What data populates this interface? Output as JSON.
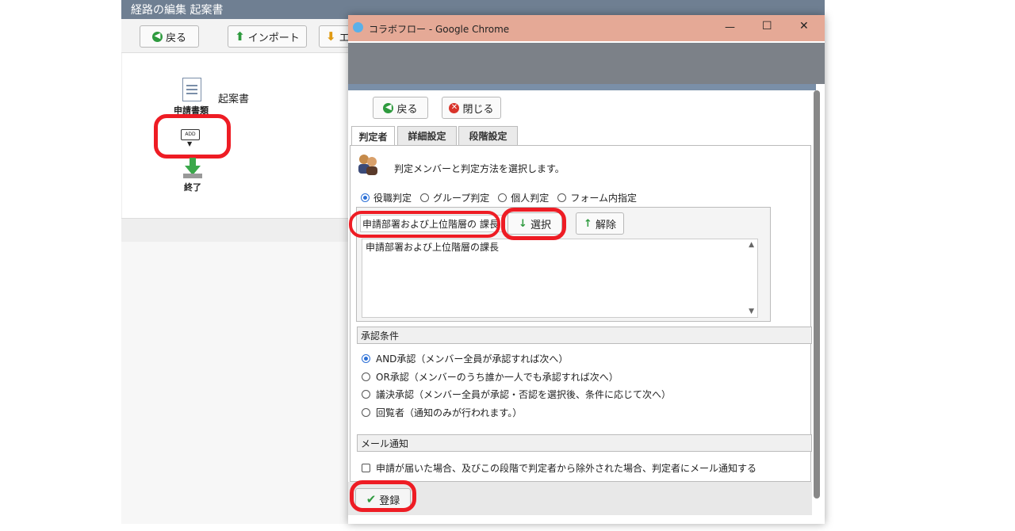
{
  "background_app": {
    "title": "経路の編集 起案書",
    "toolbar": {
      "back_label": "戻る",
      "import_label": "インポート",
      "export_label_partial": "エ"
    },
    "flow": {
      "doc_label": "申請書類",
      "doc_name": "起案書",
      "add_label": "ADD",
      "end_label": "終了"
    }
  },
  "popup": {
    "window_title": "コラボフロー - Google Chrome",
    "window_buttons": {
      "minimize": "—",
      "maximize": "☐",
      "close": "✕"
    },
    "toolbar": {
      "back_label": "戻る",
      "close_label": "閉じる"
    },
    "tabs": [
      {
        "label": "判定者",
        "active": true
      },
      {
        "label": "詳細設定",
        "active": false
      },
      {
        "label": "段階設定",
        "active": false
      }
    ],
    "description": "判定メンバーと判定方法を選択します。",
    "judge_types": [
      {
        "label": "役職判定",
        "selected": true
      },
      {
        "label": "グループ判定",
        "selected": false
      },
      {
        "label": "個人判定",
        "selected": false
      },
      {
        "label": "フォーム内指定",
        "selected": false
      }
    ],
    "role_select_value": "申請部署および上位階層の 課長",
    "select_button_label": "選択",
    "release_button_label": "解除",
    "selected_list": [
      "申請部署および上位階層の課長"
    ],
    "approval_condition": {
      "header": "承認条件",
      "options": [
        {
          "label": "AND承認（メンバー全員が承認すれば次へ）",
          "selected": true
        },
        {
          "label": "OR承認（メンバーのうち誰か一人でも承認すれば次へ）",
          "selected": false
        },
        {
          "label": "議決承認（メンバー全員が承認・否認を選択後、条件に応じて次へ）",
          "selected": false
        },
        {
          "label": "回覧者（通知のみが行われます。）",
          "selected": false
        }
      ]
    },
    "mail_notification": {
      "header": "メール通知",
      "checkbox_label": "申請が届いた場合、及びこの段階で判定者から除外された場合、判定者にメール通知する",
      "checked": false
    },
    "register_label": "登録"
  },
  "colors": {
    "annotation_red": "#ee1c24",
    "title_bar": "#e5a996",
    "accent_green": "#2e9a3e"
  }
}
